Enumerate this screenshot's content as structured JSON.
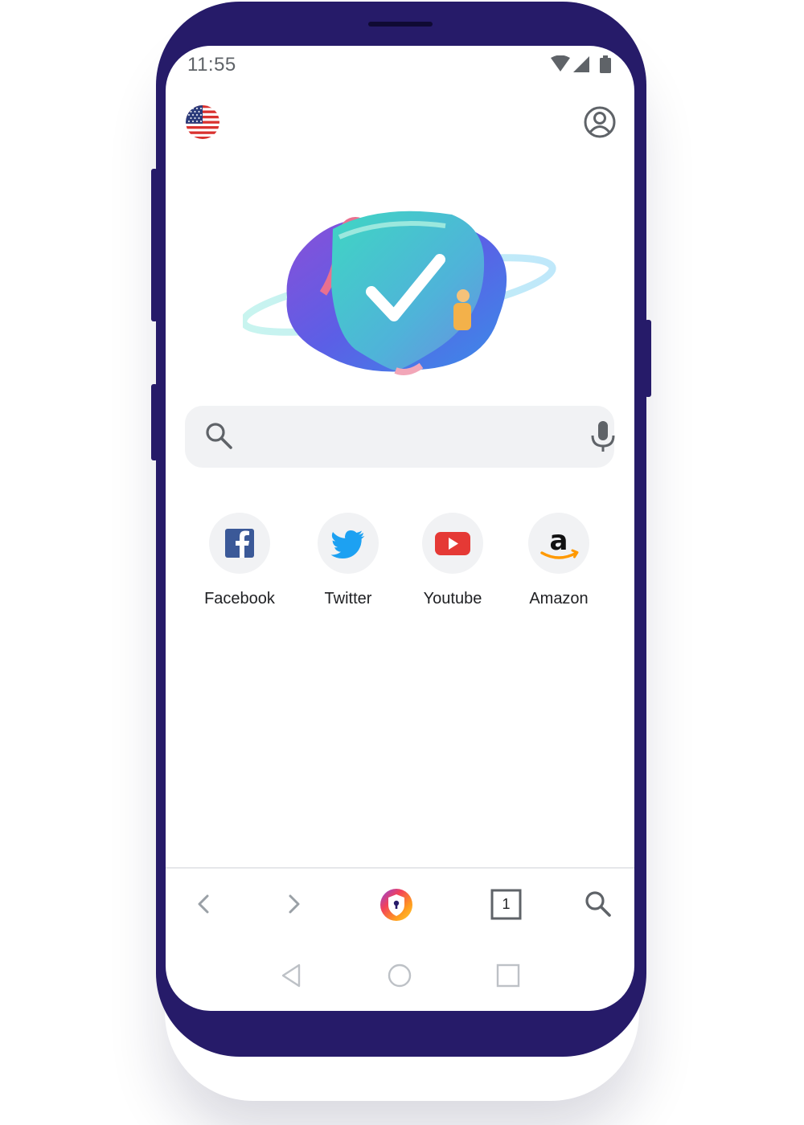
{
  "status_bar": {
    "time": "11:55",
    "icons": [
      "wifi-icon",
      "signal-icon",
      "battery-icon"
    ]
  },
  "header": {
    "left_icon": "us-flag-icon",
    "right_icon": "account-circle-icon"
  },
  "hero": {
    "icon": "shield-check-illustration"
  },
  "search": {
    "placeholder": "",
    "value": "",
    "left_icon": "search-icon",
    "right_icon": "microphone-icon"
  },
  "shortcuts": [
    {
      "label": "Facebook",
      "icon": "facebook-icon",
      "color": "#3b5998"
    },
    {
      "label": "Twitter",
      "icon": "twitter-icon",
      "color": "#1da1f2"
    },
    {
      "label": "Youtube",
      "icon": "youtube-icon",
      "color": "#e53935"
    },
    {
      "label": "Amazon",
      "icon": "amazon-icon",
      "color": "#ff9900"
    }
  ],
  "toolbar": {
    "items": [
      "back-arrow-icon",
      "forward-arrow-icon",
      "browser-logo-icon",
      "tabs-icon",
      "search-icon"
    ],
    "tab_count": "1"
  },
  "system_nav": {
    "items": [
      "back-triangle-icon",
      "home-circle-icon",
      "recents-square-icon"
    ]
  },
  "colors": {
    "phone_frame": "#261b69",
    "search_bg": "#f1f2f4",
    "icon_gray": "#5f6368"
  }
}
